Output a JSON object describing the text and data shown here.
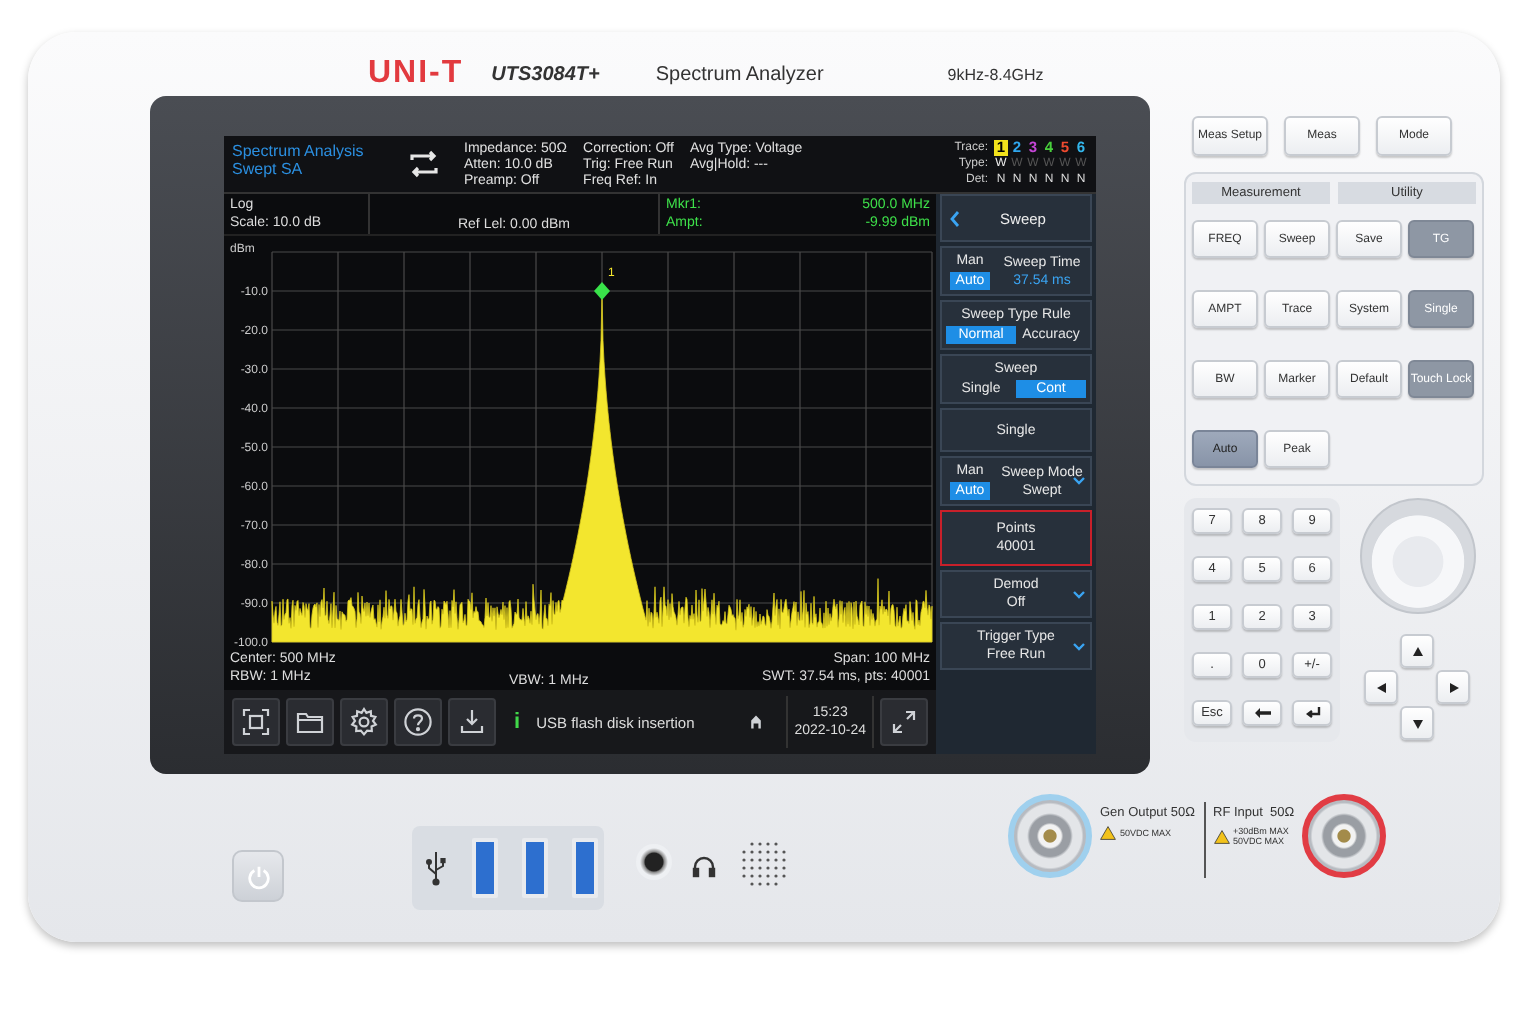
{
  "device": {
    "brand": "UNI-T",
    "model": "UTS3084T+",
    "product": "Spectrum Analyzer",
    "range": "9kHz-8.4GHz"
  },
  "screen": {
    "mode": {
      "title": "Spectrum Analysis",
      "subtitle": "Swept SA"
    },
    "info_columns": [
      [
        "Impedance: 50Ω",
        "Atten: 10.0 dB",
        "Preamp: Off"
      ],
      [
        "Correction: Off",
        "Trig: Free Run",
        "Freq Ref: In"
      ],
      [
        "Avg Type: Voltage",
        "Avg|Hold: ---"
      ]
    ],
    "trace_table": {
      "row_labels": [
        "Trace:",
        "Type:",
        "Det:"
      ],
      "traces": [
        {
          "number": "1",
          "color": "#f2e21c",
          "selected": true,
          "active": true,
          "type": "W",
          "det": "N"
        },
        {
          "number": "2",
          "color": "#2fa6ee",
          "selected": false,
          "active": false,
          "type": "W",
          "det": "N"
        },
        {
          "number": "3",
          "color": "#c445d6",
          "selected": false,
          "active": false,
          "type": "W",
          "det": "N"
        },
        {
          "number": "4",
          "color": "#48cf3c",
          "selected": false,
          "active": false,
          "type": "W",
          "det": "N"
        },
        {
          "number": "5",
          "color": "#ef4a2f",
          "selected": false,
          "active": false,
          "type": "W",
          "det": "N"
        },
        {
          "number": "6",
          "color": "#33b6ec",
          "selected": false,
          "active": false,
          "type": "W",
          "det": "N"
        }
      ]
    },
    "graph": {
      "scale_type": "Log",
      "scale": "Scale: 10.0 dB",
      "ref_level": "Ref Lel: 0.00 dBm",
      "marker_label": "Mkr1:",
      "ampt_label": "Ampt:",
      "marker_freq": "500.0 MHz",
      "marker_ampt": "-9.99 dBm",
      "marker_number": "1",
      "y_unit": "dBm",
      "y_ticks": [
        "-10.0",
        "-20.0",
        "-30.0",
        "-40.0",
        "-50.0",
        "-60.0",
        "-70.0",
        "-80.0",
        "-90.0",
        "-100.0"
      ]
    },
    "footer": {
      "center": "Center: 500 MHz",
      "rbw": "RBW: 1 MHz",
      "vbw": "VBW: 1 MHz",
      "span": "Span: 100 MHz",
      "swt": "SWT: 37.54 ms, pts: 40001"
    },
    "taskbar": {
      "info_mark": "i",
      "message": "USB flash disk insertion",
      "time": "15:23",
      "date": "2022-10-24"
    },
    "menu": {
      "title": "Sweep",
      "items": [
        {
          "kind": "auto-man",
          "options": [
            {
              "label": "Man",
              "selected": false
            },
            {
              "label": "Auto",
              "selected": true
            }
          ],
          "label": "Sweep Time",
          "value": "37.54 ms",
          "dropdown": false
        },
        {
          "kind": "segmented",
          "label": "Sweep Type Rule",
          "options": [
            {
              "label": "Normal",
              "selected": true
            },
            {
              "label": "Accuracy",
              "selected": false
            }
          ]
        },
        {
          "kind": "segmented",
          "label": "Sweep",
          "options": [
            {
              "label": "Single",
              "selected": false
            },
            {
              "label": "Cont",
              "selected": true
            }
          ]
        },
        {
          "kind": "button",
          "label": "Single"
        },
        {
          "kind": "auto-man",
          "options": [
            {
              "label": "Man",
              "selected": false
            },
            {
              "label": "Auto",
              "selected": true
            }
          ],
          "label": "Sweep Mode",
          "value": "Swept",
          "dropdown": true
        },
        {
          "kind": "value",
          "label": "Points",
          "value": "40001",
          "selected": true
        },
        {
          "kind": "dropdown",
          "label": "Demod",
          "value": "Off"
        },
        {
          "kind": "dropdown",
          "label": "Trigger Type",
          "value": "Free Run"
        }
      ]
    }
  },
  "panel": {
    "top_keys": [
      "Meas Setup",
      "Meas",
      "Mode"
    ],
    "sections": [
      "Measurement",
      "Utility"
    ],
    "keys": [
      {
        "label": "FREQ",
        "disabled": false,
        "selected": false
      },
      {
        "label": "Sweep",
        "disabled": false,
        "selected": false
      },
      {
        "label": "Save",
        "disabled": false,
        "selected": false
      },
      {
        "label": "TG",
        "disabled": true,
        "selected": false
      },
      {
        "label": "AMPT",
        "disabled": false,
        "selected": false
      },
      {
        "label": "Trace",
        "disabled": false,
        "selected": false
      },
      {
        "label": "System",
        "disabled": false,
        "selected": false
      },
      {
        "label": "Single",
        "disabled": true,
        "selected": false
      },
      {
        "label": "BW",
        "disabled": false,
        "selected": false
      },
      {
        "label": "Marker",
        "disabled": false,
        "selected": false
      },
      {
        "label": "Default",
        "disabled": false,
        "selected": false
      },
      {
        "label": "Touch Lock",
        "disabled": true,
        "selected": false
      },
      {
        "label": "Auto",
        "disabled": false,
        "selected": true
      },
      {
        "label": "Peak",
        "disabled": false,
        "selected": false
      }
    ],
    "numpad": [
      "7",
      "8",
      "9",
      "4",
      "5",
      "6",
      "1",
      "2",
      "3",
      ".",
      "0",
      "+/-"
    ],
    "esc": "Esc"
  },
  "connectors": {
    "gen_output": "Gen Output 50Ω",
    "gen_warning": "50VDC MAX",
    "rf_input": "RF Input  50Ω",
    "rf_warnings": [
      "+30dBm MAX",
      "50VDC MAX"
    ]
  }
}
